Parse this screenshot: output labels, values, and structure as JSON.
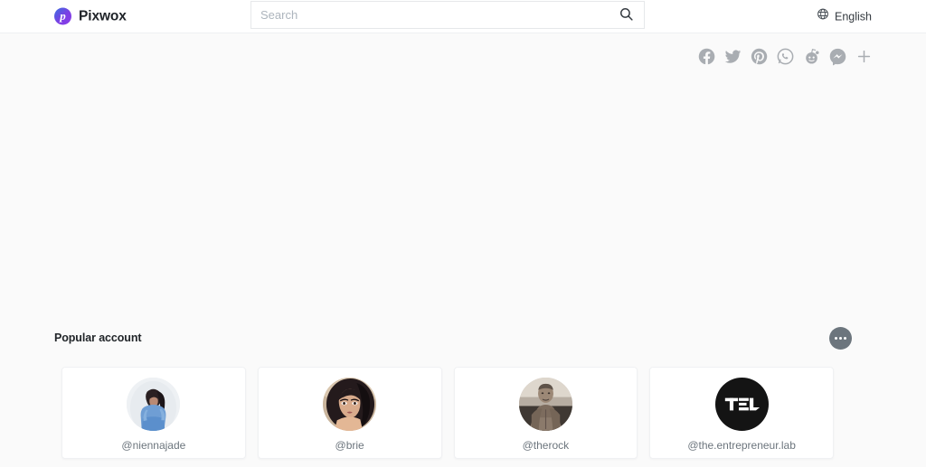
{
  "header": {
    "brand_name": "Pixwox",
    "brand_logo_letter": "p",
    "brand_logo_gradient_from": "#3b6fe0",
    "brand_logo_gradient_to": "#8b3de8",
    "search": {
      "placeholder": "Search",
      "value": "",
      "icon": "search-icon"
    },
    "language": {
      "label": "English",
      "icon": "globe-icon"
    }
  },
  "share": {
    "items": [
      {
        "name": "facebook",
        "icon": "facebook-icon"
      },
      {
        "name": "twitter",
        "icon": "twitter-icon"
      },
      {
        "name": "pinterest",
        "icon": "pinterest-icon"
      },
      {
        "name": "whatsapp",
        "icon": "whatsapp-icon"
      },
      {
        "name": "reddit",
        "icon": "reddit-icon"
      },
      {
        "name": "messenger",
        "icon": "messenger-icon"
      },
      {
        "name": "more",
        "icon": "plus-icon"
      }
    ],
    "color": "#a9adb2"
  },
  "popular": {
    "title": "Popular account",
    "more_button_icon": "ellipsis-icon",
    "more_button_color": "#6c757d",
    "accounts": [
      {
        "username": "@niennajade",
        "avatar": "woman-blue-outfit"
      },
      {
        "username": "@brie",
        "avatar": "woman-dark-hair"
      },
      {
        "username": "@therock",
        "avatar": "muscular-man-sepia"
      },
      {
        "username": "@the.entrepreneur.lab",
        "avatar": "tel-black-logo"
      }
    ]
  }
}
